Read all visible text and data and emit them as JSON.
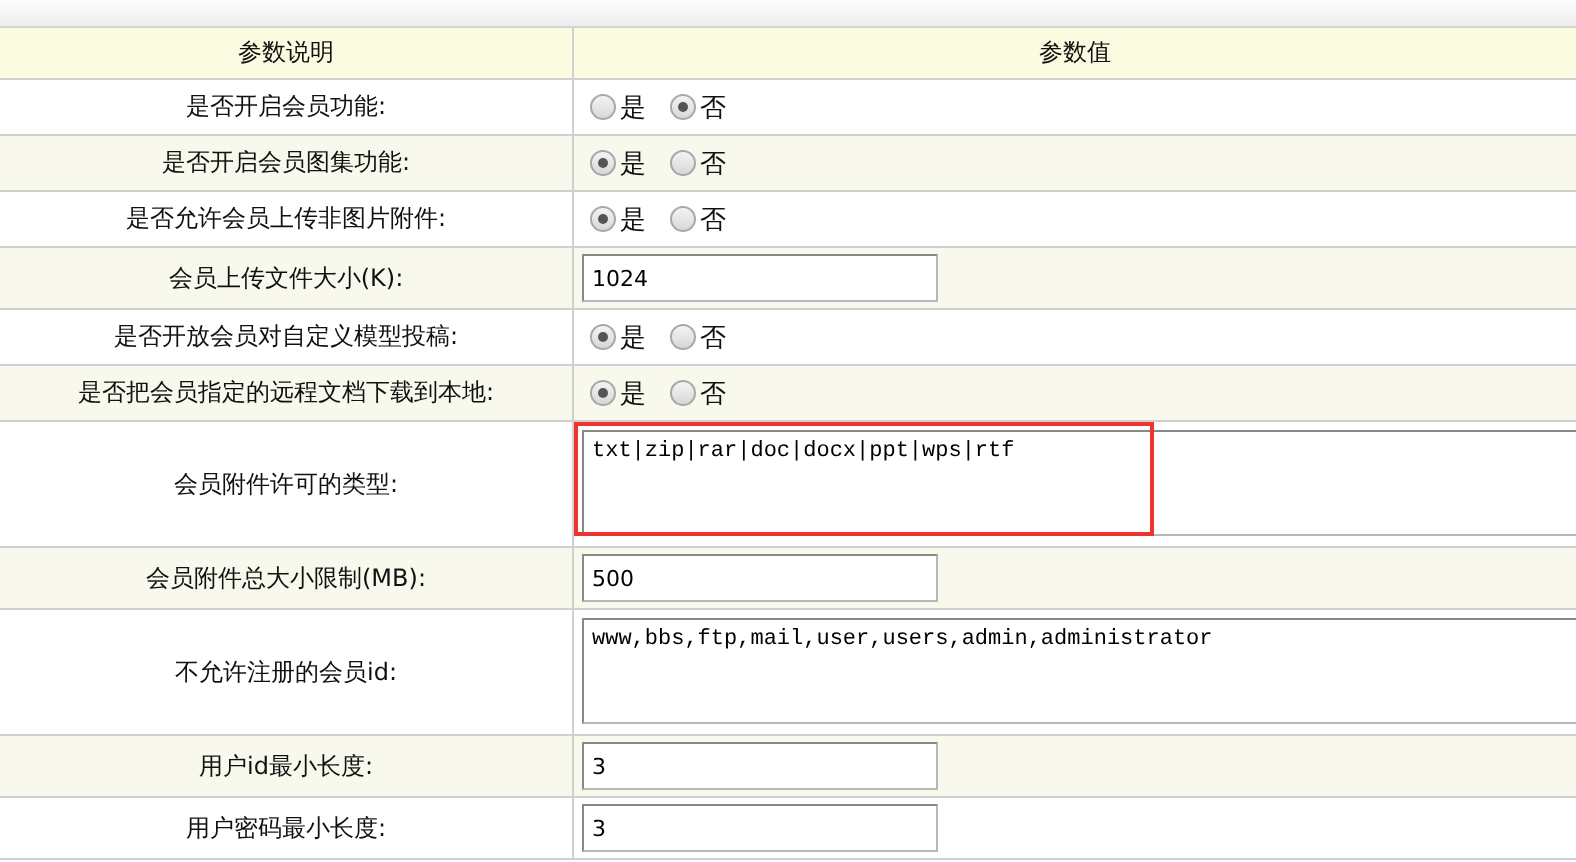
{
  "table": {
    "columns": [
      "参数说明",
      "参数值"
    ],
    "rows": [
      {
        "label": "是否开启会员功能:",
        "kind": "radio",
        "options": [
          {
            "label": "是",
            "selected": false
          },
          {
            "label": "否",
            "selected": true
          }
        ]
      },
      {
        "label": "是否开启会员图集功能:",
        "kind": "radio",
        "options": [
          {
            "label": "是",
            "selected": true
          },
          {
            "label": "否",
            "selected": false
          }
        ]
      },
      {
        "label": "是否允许会员上传非图片附件:",
        "kind": "radio",
        "options": [
          {
            "label": "是",
            "selected": true
          },
          {
            "label": "否",
            "selected": false
          }
        ]
      },
      {
        "label": "会员上传文件大小(K):",
        "kind": "text",
        "value": "1024"
      },
      {
        "label": "是否开放会员对自定义模型投稿:",
        "kind": "radio",
        "options": [
          {
            "label": "是",
            "selected": true
          },
          {
            "label": "否",
            "selected": false
          }
        ]
      },
      {
        "label": "是否把会员指定的远程文档下载到本地:",
        "kind": "radio",
        "options": [
          {
            "label": "是",
            "selected": true
          },
          {
            "label": "否",
            "selected": false
          }
        ]
      },
      {
        "label": "会员附件许可的类型:",
        "kind": "textarea",
        "value": "txt|zip|rar|doc|docx|ppt|wps|rtf",
        "highlighted": true
      },
      {
        "label": "会员附件总大小限制(MB):",
        "kind": "text",
        "value": "500"
      },
      {
        "label": "不允许注册的会员id:",
        "kind": "textarea",
        "value": "www,bbs,ftp,mail,user,users,admin,administrator",
        "highlighted": false
      },
      {
        "label": "用户id最小长度:",
        "kind": "text",
        "value": "3"
      },
      {
        "label": "用户密码最小长度:",
        "kind": "text",
        "value": "3"
      }
    ]
  }
}
